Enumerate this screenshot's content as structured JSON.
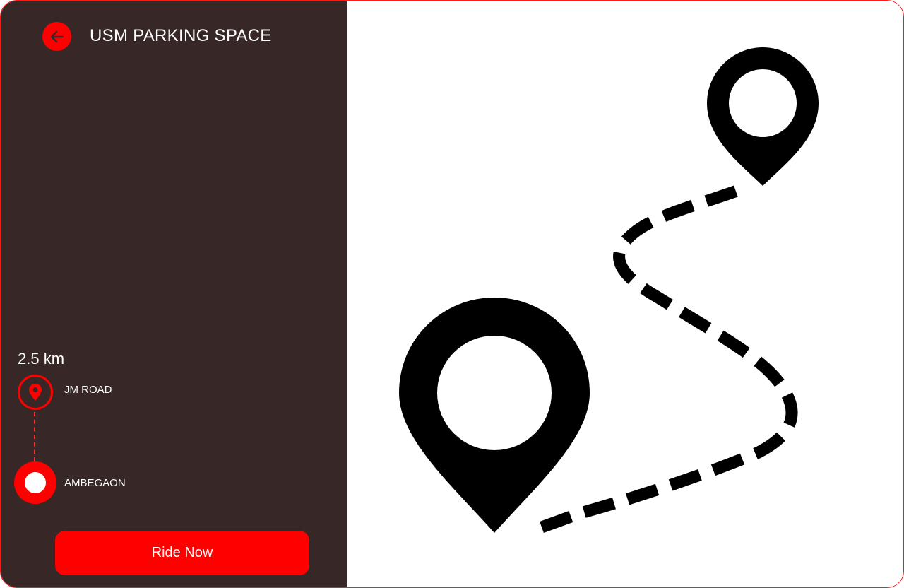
{
  "header": {
    "title": "USM PARKING SPACE",
    "back_icon": "arrow-left-icon"
  },
  "trip": {
    "distance": "2.5 km",
    "origin": {
      "label": "JM ROAD",
      "icon": "location-pin-icon"
    },
    "destination": {
      "label": "AMBEGAON",
      "icon": "destination-dot-icon"
    }
  },
  "actions": {
    "ride_label": "Ride Now"
  },
  "map": {
    "illustration": "route-map-illustration",
    "start_pin_icon": "map-pin-large-icon",
    "end_pin_icon": "map-pin-small-icon"
  },
  "colors": {
    "accent": "#ff0000",
    "sidebar_bg": "#372727",
    "text": "#ffffff",
    "map_bg": "#ffffff",
    "illustration": "#000000"
  }
}
